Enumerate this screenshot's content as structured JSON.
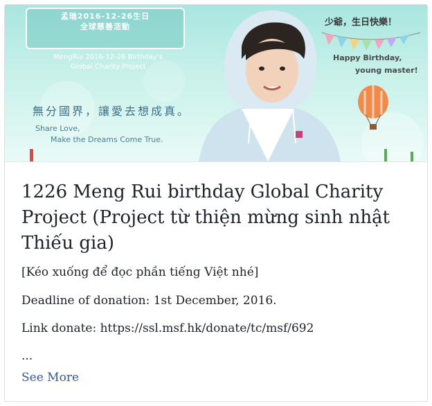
{
  "post": {
    "banner": {
      "scroll_line1": "孟瑞2016-12-26生日",
      "scroll_line2": "全球慈善活動",
      "scroll_line3": "MengRui 2016-12-26 Birthday's",
      "scroll_line4": "Global Charity Project",
      "zh_slogan": "無分國界，讓愛去想成真。",
      "share_love": "Share Love,",
      "make_dreams": "Make the Dreams Come True.",
      "zh_greeting": "少爺，生日快樂！",
      "happy_birthday": "Happy Birthday,",
      "young_master": "young master!"
    },
    "title": "1226 Meng Rui birthday Global Charity Project (Project từ thiện mừng sinh nhật Thiếu gia)",
    "lines": [
      "[Kéo xuống để đọc phần tiếng Việt nhé]",
      "Deadline of donation: 1st December, 2016.",
      "Link donate: https://ssl.msf.hk/donate/tc/msf/692",
      "..."
    ],
    "see_more": "See More"
  },
  "colors": {
    "title": "#1d2129",
    "link": "#365899",
    "banner": "#a8e6df"
  }
}
